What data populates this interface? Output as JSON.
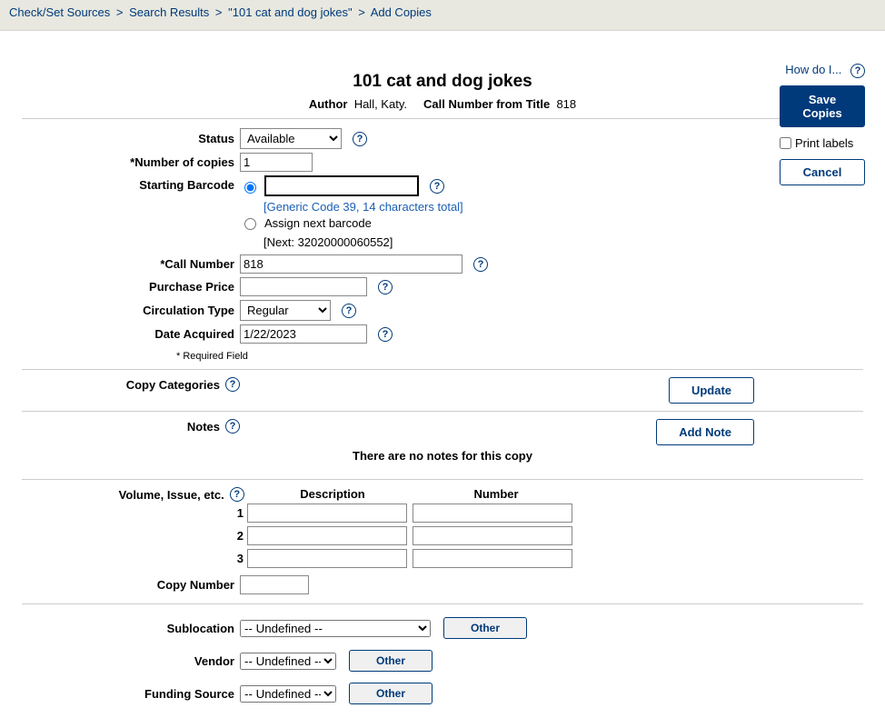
{
  "breadcrumb": {
    "items": [
      "Check/Set Sources",
      "Search Results",
      "\"101 cat and dog jokes\"",
      "Add Copies"
    ]
  },
  "help": {
    "label": "How do I..."
  },
  "actions": {
    "save": "Save Copies",
    "print_labels": "Print labels",
    "cancel": "Cancel"
  },
  "title": {
    "heading": "101 cat and dog jokes",
    "author_label": "Author",
    "author": "Hall, Katy.",
    "callnum_label": "Call Number from Title",
    "callnum": "818"
  },
  "fields": {
    "status_label": "Status",
    "status_value": "Available",
    "num_copies_label": "*Number of copies",
    "num_copies_value": "1",
    "starting_barcode_label": "Starting Barcode",
    "barcode_hint": "[Generic Code 39, 14 characters total]",
    "assign_next_label": "Assign next barcode",
    "next_barcode": "[Next: 32020000060552]",
    "call_label": "*Call Number",
    "call_value": "818",
    "price_label": "Purchase Price",
    "circ_label": "Circulation Type",
    "circ_value": "Regular",
    "date_label": "Date Acquired",
    "date_value": "1/22/2023",
    "required_note": "* Required Field"
  },
  "categories": {
    "label": "Copy Categories",
    "update": "Update"
  },
  "notes": {
    "label": "Notes",
    "add": "Add Note",
    "none": "There are no notes for this copy"
  },
  "volume": {
    "label": "Volume, Issue, etc.",
    "desc_header": "Description",
    "num_header": "Number",
    "rows": [
      "1",
      "2",
      "3"
    ],
    "copy_num_label": "Copy Number"
  },
  "bottom": {
    "sublocation_label": "Sublocation",
    "sublocation_value": "-- Undefined --",
    "vendor_label": "Vendor",
    "vendor_value": "-- Undefined --",
    "funding_label": "Funding Source",
    "funding_value": "-- Undefined --",
    "other": "Other"
  }
}
